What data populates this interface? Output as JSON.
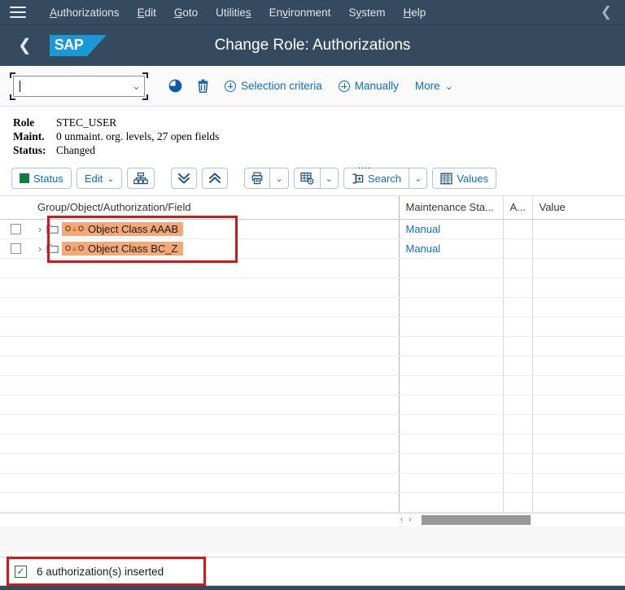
{
  "menubar": {
    "burger_icon": "hamburger-menu-icon",
    "items": [
      {
        "label": "Authorizations",
        "accel": "A"
      },
      {
        "label": "Edit",
        "accel": "E"
      },
      {
        "label": "Goto",
        "accel": "G"
      },
      {
        "label": "Utilities",
        "accel": "s"
      },
      {
        "label": "Environment",
        "accel": "v"
      },
      {
        "label": "System",
        "accel": "y"
      },
      {
        "label": "Help",
        "accel": "H"
      }
    ],
    "collapse_icon": "chevron-left-icon"
  },
  "shellbar": {
    "back_icon": "chevron-left-icon",
    "logo_text": "SAP",
    "title": "Change Role: Authorizations",
    "background": "#354a5f",
    "logo_color": "#199ad6"
  },
  "toolbar": {
    "combo_value": "",
    "combo_placeholder": "",
    "dropdown_icon": "chevron-down-icon",
    "color_fill_icon": "color-fill-icon",
    "delete_icon": "trash-icon",
    "selection_criteria_label": "Selection criteria",
    "manually_label": "Manually",
    "more_label": "More"
  },
  "role_info": {
    "role_label": "Role",
    "role_value": "STEC_USER",
    "maint_label": "Maint.",
    "maint_value": "0 unmaint. org. levels, 27 open fields",
    "status_label": "Status:",
    "status_value": "Changed"
  },
  "toolbar2": {
    "status_label": "Status",
    "status_color": "#107e3e",
    "edit_label": "Edit",
    "org_levels_icon": "org-levels-icon",
    "expand_all_icon": "double-chevron-down-icon",
    "collapse_all_icon": "double-chevron-up-icon",
    "print_icon": "print-icon",
    "table_settings_icon": "table-settings-icon",
    "search_label": "Search",
    "search_icon": "search-insert-icon",
    "values_label": "Values",
    "values_icon": "values-table-icon",
    "drag_handle": "...."
  },
  "table": {
    "columns": [
      {
        "key": "checkbox",
        "label": ""
      },
      {
        "key": "main",
        "label": "Group/Object/Authorization/Field"
      },
      {
        "key": "status",
        "label": "Maintenance Sta..."
      },
      {
        "key": "a",
        "label": "A..."
      },
      {
        "key": "value",
        "label": "Value"
      }
    ],
    "rows": [
      {
        "name": "Object Class AAAB",
        "maintenance_status": "Manual",
        "a": "",
        "value": "",
        "expander": "›",
        "highlight": "#f4a875"
      },
      {
        "name": "Object Class BC_Z",
        "maintenance_status": "Manual",
        "a": "",
        "value": "",
        "expander": "›",
        "highlight": "#f4a875"
      }
    ],
    "empty_row_count": 13,
    "node_glyph": "O▲O",
    "folder_icon": "folder-icon",
    "scroll_left_icon": "scroll-left-icon",
    "scroll_right_icon": "scroll-right-icon"
  },
  "statusbar": {
    "icon": "checkbox-checked-icon",
    "message": "6 authorization(s) inserted",
    "icon_color": "#107e3e"
  },
  "annotations": {
    "highlight_color": "#d01919",
    "box_rows_label": "annotation-rows",
    "box_status_label": "annotation-status-message"
  }
}
